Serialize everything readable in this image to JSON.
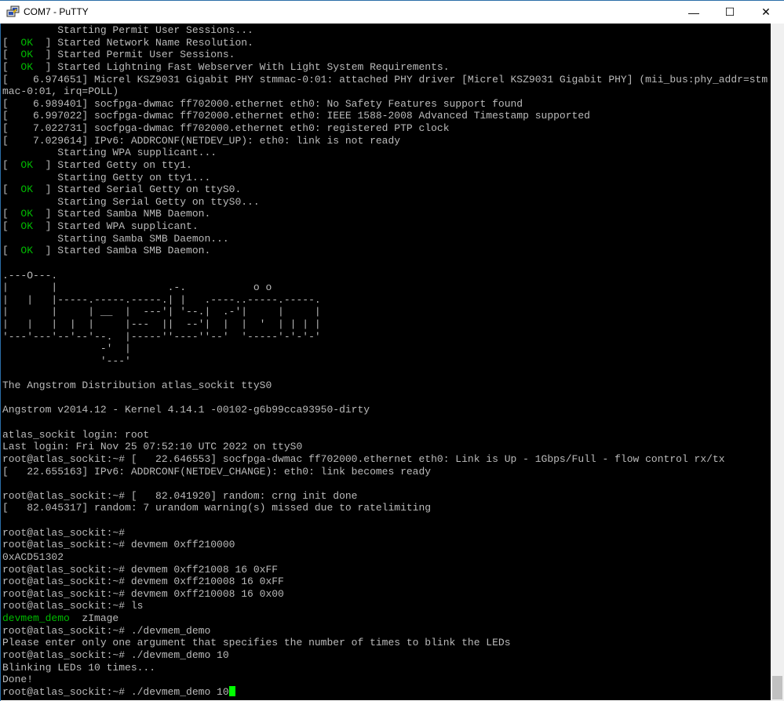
{
  "window": {
    "title": "COM7 - PuTTY",
    "minimize": "—",
    "maximize": "☐",
    "close": "✕"
  },
  "colors": {
    "ok": "#00bb00",
    "text": "#bbbbbb",
    "background": "#000000",
    "cursor": "#00ff00"
  },
  "terminal": {
    "lines": [
      {
        "t": "         Starting Permit User Sessions..."
      },
      {
        "ok": true,
        "t": "Started Network Name Resolution."
      },
      {
        "ok": true,
        "t": "Started Permit User Sessions."
      },
      {
        "ok": true,
        "t": "Started Lightning Fast Webserver With Light System Requirements."
      },
      {
        "t": "[    6.974651] Micrel KSZ9031 Gigabit PHY stmmac-0:01: attached PHY driver [Micrel KSZ9031 Gigabit PHY] (mii_bus:phy_addr=stm"
      },
      {
        "t": "mac-0:01, irq=POLL)"
      },
      {
        "t": "[    6.989401] socfpga-dwmac ff702000.ethernet eth0: No Safety Features support found"
      },
      {
        "t": "[    6.997022] socfpga-dwmac ff702000.ethernet eth0: IEEE 1588-2008 Advanced Timestamp supported"
      },
      {
        "t": "[    7.022731] socfpga-dwmac ff702000.ethernet eth0: registered PTP clock"
      },
      {
        "t": "[    7.029614] IPv6: ADDRCONF(NETDEV_UP): eth0: link is not ready"
      },
      {
        "t": "         Starting WPA supplicant..."
      },
      {
        "ok": true,
        "t": "Started Getty on tty1."
      },
      {
        "t": "         Starting Getty on tty1..."
      },
      {
        "ok": true,
        "t": "Started Serial Getty on ttyS0."
      },
      {
        "t": "         Starting Serial Getty on ttyS0..."
      },
      {
        "ok": true,
        "t": "Started Samba NMB Daemon."
      },
      {
        "ok": true,
        "t": "Started WPA supplicant."
      },
      {
        "t": "         Starting Samba SMB Daemon..."
      },
      {
        "ok": true,
        "t": "Started Samba SMB Daemon."
      },
      {
        "t": ""
      },
      {
        "t": ".---O---.                                           "
      },
      {
        "t": "|       |                  .-.           o o        "
      },
      {
        "t": "|   |   |-----.-----.-----.| |   .----..-----.-----."
      },
      {
        "t": "|       |     | __  |  ---'| '--.|  .-'|     |     |"
      },
      {
        "t": "|   |   |  |  |     |---  ||  --'|  |  |  '  | | | |"
      },
      {
        "t": "'---'---'--'--'--.  |-----''----''--'  '-----'-'-'-'"
      },
      {
        "t": "                -'  |"
      },
      {
        "t": "                '---'"
      },
      {
        "t": ""
      },
      {
        "t": "The Angstrom Distribution atlas_sockit ttyS0"
      },
      {
        "t": ""
      },
      {
        "t": "Angstrom v2014.12 - Kernel 4.14.1 -00102-g6b99cca93950-dirty"
      },
      {
        "t": ""
      },
      {
        "t": "atlas_sockit login: root"
      },
      {
        "t": "Last login: Fri Nov 25 07:52:10 UTC 2022 on ttyS0"
      },
      {
        "t": "root@atlas_sockit:~# [   22.646553] socfpga-dwmac ff702000.ethernet eth0: Link is Up - 1Gbps/Full - flow control rx/tx"
      },
      {
        "t": "[   22.655163] IPv6: ADDRCONF(NETDEV_CHANGE): eth0: link becomes ready"
      },
      {
        "t": ""
      },
      {
        "t": "root@atlas_sockit:~# [   82.041920] random: crng init done"
      },
      {
        "t": "[   82.045317] random: 7 urandom warning(s) missed due to ratelimiting"
      },
      {
        "t": ""
      },
      {
        "t": "root@atlas_sockit:~#"
      },
      {
        "t": "root@atlas_sockit:~# devmem 0xff210000"
      },
      {
        "t": "0xACD51302"
      },
      {
        "t": "root@atlas_sockit:~# devmem 0xff21008 16 0xFF"
      },
      {
        "t": "root@atlas_sockit:~# devmem 0xff210008 16 0xFF"
      },
      {
        "t": "root@atlas_sockit:~# devmem 0xff210008 16 0x00"
      },
      {
        "t": "root@atlas_sockit:~# ls"
      },
      {
        "green": "devmem_demo",
        "t": "  zImage"
      },
      {
        "t": "root@atlas_sockit:~# ./devmem_demo"
      },
      {
        "t": "Please enter only one argument that specifies the number of times to blink the LEDs"
      },
      {
        "t": "root@atlas_sockit:~# ./devmem_demo 10"
      },
      {
        "t": "Blinking LEDs 10 times..."
      },
      {
        "t": "Done!"
      },
      {
        "t": "root@atlas_sockit:~# ./devmem_demo 10",
        "cursor": true
      }
    ],
    "ok_label": "OK"
  }
}
